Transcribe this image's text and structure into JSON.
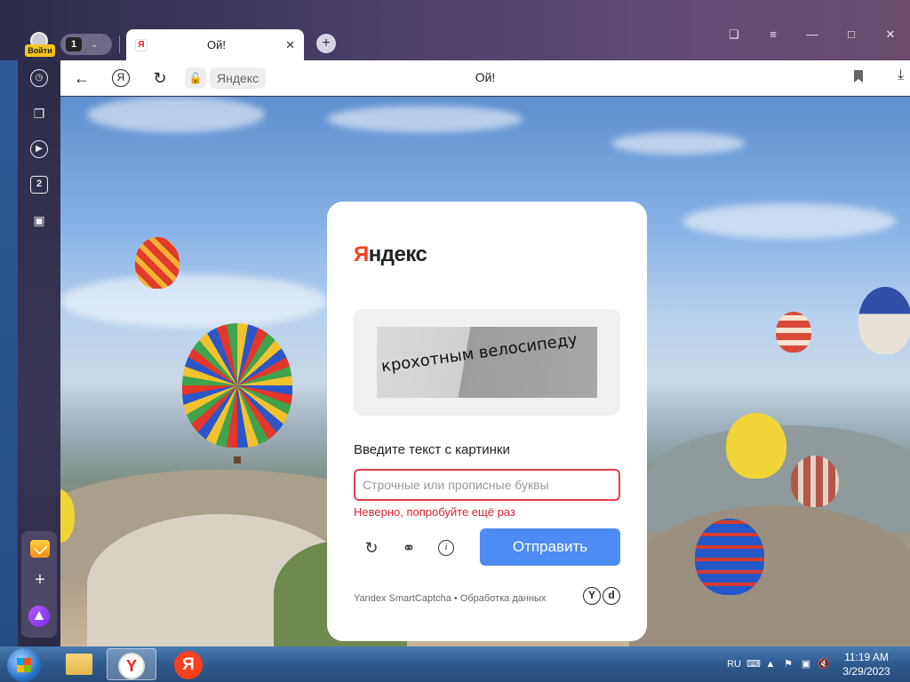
{
  "browser": {
    "tab_count": "1",
    "tab_title": "Ой!",
    "page_title": "Ой!",
    "domain": "Яндекс",
    "login_badge": "Войти"
  },
  "captcha": {
    "logo_first": "Я",
    "logo_rest": "ндекс",
    "image_text": "крохотным велосипеду",
    "prompt": "Введите текст с картинки",
    "placeholder": "Строчные или прописные буквы",
    "error": "Неверно, попробуйте ещё раз",
    "submit_label": "Отправить",
    "footer": "Yandex SmartCaptcha • Обработка данных"
  },
  "sidebar": {
    "badge_number": "2"
  },
  "taskbar": {
    "language": "RU",
    "time": "11:19 AM",
    "date": "3/29/2023"
  },
  "colors": {
    "accent_button": "#4d8cf5",
    "error_red": "#d9232e",
    "yandex_red": "#fc3f1d"
  },
  "icons": [
    "back-icon",
    "yandex-icon",
    "reload-icon",
    "lock-icon",
    "bookmark-icon",
    "download-icon",
    "history-icon",
    "collections-icon",
    "video-icon",
    "screenshot-icon",
    "refresh-icon",
    "headphones-icon",
    "info-icon"
  ]
}
